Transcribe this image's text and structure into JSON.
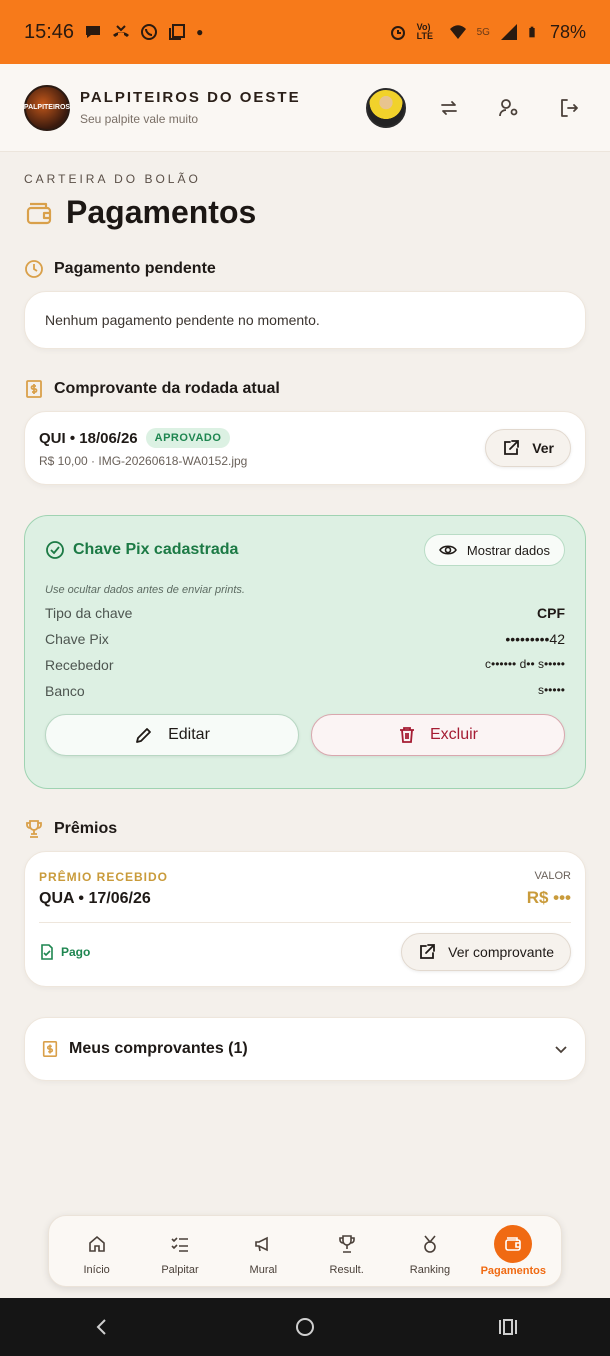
{
  "status_bar": {
    "time": "15:46",
    "battery": "78%",
    "network": "5G",
    "lte_label": "Vo) LTE"
  },
  "header": {
    "brand_title": "PALPITEIROS DO OESTE",
    "brand_subtitle": "Seu palpite vale muito",
    "logo_text": "PALPITEIROS"
  },
  "page": {
    "overline": "CARTEIRA DO BOLÃO",
    "title": "Pagamentos"
  },
  "pending": {
    "title": "Pagamento pendente",
    "message": "Nenhum pagamento pendente no momento."
  },
  "receipt": {
    "title": "Comprovante da rodada atual",
    "date": "QUI • 18/06/26",
    "status": "APROVADO",
    "details": "R$ 10,00 · IMG-20260618-WA0152.jpg",
    "view_label": "Ver"
  },
  "pix": {
    "title": "Chave Pix cadastrada",
    "show_label": "Mostrar dados",
    "hint": "Use ocultar dados antes de enviar prints.",
    "rows": [
      {
        "label": "Tipo da chave",
        "value": "CPF"
      },
      {
        "label": "Chave Pix",
        "value": "•••••••••42"
      },
      {
        "label": "Recebedor",
        "value": "c•••••• d•• s•••••"
      },
      {
        "label": "Banco",
        "value": "s•••••"
      }
    ],
    "edit_label": "Editar",
    "delete_label": "Excluir"
  },
  "prizes": {
    "title": "Prêmios",
    "received_label": "PRÊMIO RECEBIDO",
    "date": "QUA • 17/06/26",
    "value_label": "VALOR",
    "value": "R$ •••",
    "paid_label": "Pago",
    "view_receipt_label": "Ver comprovante"
  },
  "my_receipts": {
    "label": "Meus comprovantes (1)"
  },
  "bottom_nav": {
    "items": [
      {
        "label": "Início",
        "icon": "home-icon"
      },
      {
        "label": "Palpitar",
        "icon": "checklist-icon"
      },
      {
        "label": "Mural",
        "icon": "megaphone-icon"
      },
      {
        "label": "Result.",
        "icon": "trophy-icon"
      },
      {
        "label": "Ranking",
        "icon": "medal-icon"
      },
      {
        "label": "Pagamentos",
        "icon": "wallet-icon",
        "active": true
      }
    ]
  },
  "colors": {
    "status_bar": "#f77a1a",
    "accent": "#f06a12",
    "success": "#1e8650",
    "danger": "#a51c33",
    "gold": "#c99b3b"
  }
}
